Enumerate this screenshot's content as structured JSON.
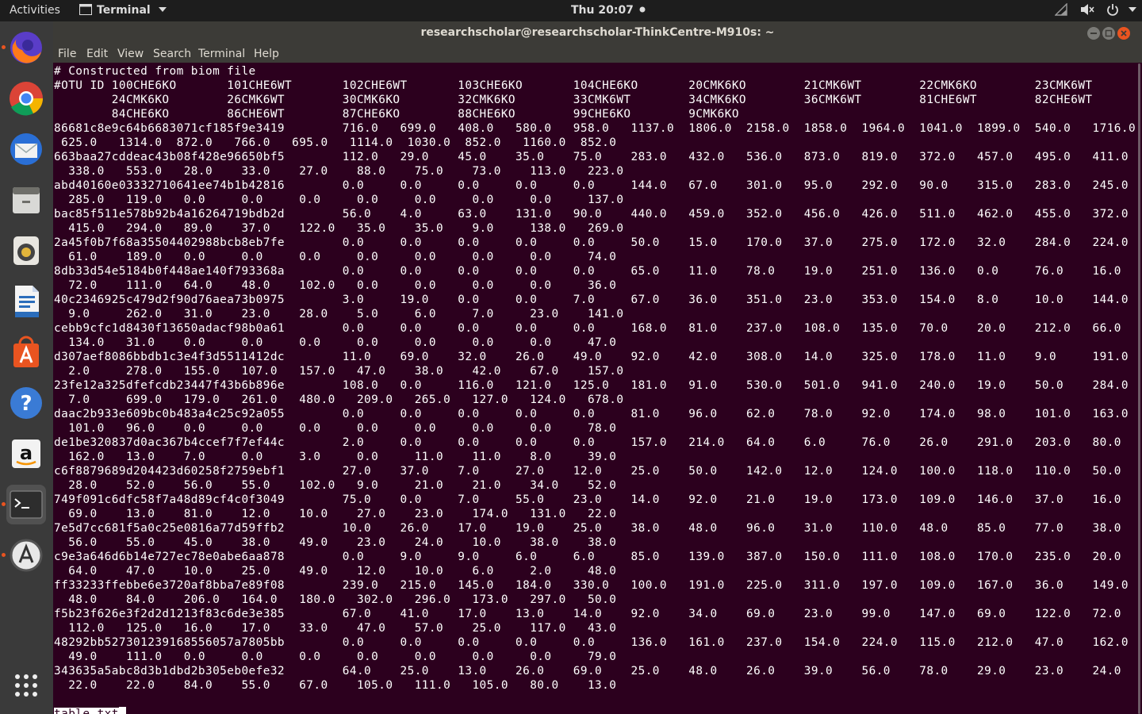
{
  "topbar": {
    "activities": "Activities",
    "app_name": "Terminal",
    "clock": "Thu 20:07"
  },
  "window": {
    "title": "researchscholar@researchscholar-ThinkCentre-M910s: ~"
  },
  "menu": [
    "File",
    "Edit",
    "View",
    "Search",
    "Terminal",
    "Help"
  ],
  "dock": [
    "firefox-icon",
    "chrome-icon",
    "thunderbird-icon",
    "files-icon",
    "rhythmbox-icon",
    "writer-icon",
    "software-center-icon",
    "help-icon",
    "amazon-icon",
    "terminal-icon",
    "software-updater-icon",
    "show-applications-icon"
  ],
  "colors": {
    "terminal_bg": "#2c001e",
    "topbar_bg": "#1d1d1d",
    "window_chrome": "#3c3b37",
    "close_button": "#e95420"
  },
  "terminal": {
    "lines": [
      "# Constructed from biom file",
      "#OTU ID 100CHE6KO       101CHE6WT       102CHE6WT       103CHE6KO       104CHE6KO       20CMK6KO        21CMK6WT        22CMK6KO        23CMK6WT",
      "        24CMK6KO        26CMK6WT        30CMK6KO        32CMK6KO        33CMK6WT        34CMK6KO        36CMK6WT        81CHE6WT        82CHE6WT",
      "        84CHE6KO        86CHE6WT        87CHE6KO        88CHE6KO        99CHE6KO        9CMK6KO",
      "86681c8e9c64b6683071cf185f9e3419        716.0   699.0   408.0   580.0   958.0   1137.0  1806.0  2158.0  1858.0  1964.0  1041.0  1899.0  540.0   1716.0",
      " 625.0   1314.0  872.0   766.0   695.0   1114.0  1030.0  852.0   1160.0  852.0",
      "663baa27cddeac43b08f428e96650bf5        112.0   29.0    45.0    35.0    75.0    283.0   432.0   536.0   873.0   819.0   372.0   457.0   495.0   411.0",
      "  338.0   553.0   28.0    33.0    27.0    88.0    75.0    73.0    113.0   223.0",
      "abd40160e03332710641ee74b1b42816        0.0     0.0     0.0     0.0     0.0     144.0   67.0    301.0   95.0    292.0   90.0    315.0   283.0   245.0",
      "  285.0   119.0   0.0     0.0     0.0     0.0     0.0     0.0     0.0     137.0",
      "bac85f511e578b92b4a16264719bdb2d        56.0    4.0     63.0    131.0   90.0    440.0   459.0   352.0   456.0   426.0   511.0   462.0   455.0   372.0",
      "  415.0   294.0   89.0    37.0    122.0   35.0    35.0    9.0     138.0   269.0",
      "2a45f0b7f68a35504402988bcb8eb7fe        0.0     0.0     0.0     0.0     0.0     50.0    15.0    170.0   37.0    275.0   172.0   32.0    284.0   224.0",
      "  61.0    189.0   0.0     0.0     0.0     0.0     0.0     0.0     0.0     74.0",
      "8db33d54e5184b0f448ae140f793368a        0.0     0.0     0.0     0.0     0.0     65.0    11.0    78.0    19.0    251.0   136.0   0.0     76.0    16.0",
      "  72.0    111.0   64.0    48.0    102.0   0.0     0.0     0.0     0.0     36.0",
      "40c2346925c479d2f90d76aea73b0975        3.0     19.0    0.0     0.0     7.0     67.0    36.0    351.0   23.0    353.0   154.0   8.0     10.0    144.0",
      "  9.0     262.0   31.0    23.0    28.0    5.0     6.0     7.0     23.0    141.0",
      "cebb9cfc1d8430f13650adacf98b0a61        0.0     0.0     0.0     0.0     0.0     168.0   81.0    237.0   108.0   135.0   70.0    20.0    212.0   66.0",
      "  134.0   31.0    0.0     0.0     0.0     0.0     0.0     0.0     0.0     47.0",
      "d307aef8086bbdb1c3e4f3d5511412dc        11.0    69.0    32.0    26.0    49.0    92.0    42.0    308.0   14.0    325.0   178.0   11.0    9.0     191.0",
      "  2.0     278.0   155.0   107.0   157.0   47.0    38.0    42.0    67.0    157.0",
      "23fe12a325dfefcdb23447f43b6b896e        108.0   0.0     116.0   121.0   125.0   181.0   91.0    530.0   501.0   941.0   240.0   19.0    50.0    284.0",
      "  7.0     699.0   179.0   261.0   480.0   209.0   265.0   127.0   124.0   678.0",
      "daac2b933e609bc0b483a4c25c92a055        0.0     0.0     0.0     0.0     0.0     81.0    96.0    62.0    78.0    92.0    174.0   98.0    101.0   163.0",
      "  101.0   96.0    0.0     0.0     0.0     0.0     0.0     0.0     0.0     78.0",
      "de1be320837d0ac367b4ccef7f7ef44c        2.0     0.0     0.0     0.0     0.0     157.0   214.0   64.0    6.0     76.0    26.0    291.0   203.0   80.0",
      "  162.0   13.0    7.0     0.0     3.0     0.0     11.0    11.0    8.0     39.0",
      "c6f8879689d204423d60258f2759ebf1        27.0    37.0    7.0     27.0    12.0    25.0    50.0    142.0   12.0    124.0   100.0   118.0   110.0   50.0",
      "  28.0    52.0    56.0    55.0    102.0   9.0     21.0    21.0    34.0    52.0",
      "749f091c6dfc58f7a48d89cf4c0f3049        75.0    0.0     7.0     55.0    23.0    14.0    92.0    21.0    19.0    173.0   109.0   146.0   37.0    16.0",
      "  69.0    13.0    81.0    12.0    10.0    27.0    23.0    174.0   131.0   22.0",
      "7e5d7cc681f5a0c25e0816a77d59ffb2        10.0    26.0    17.0    19.0    25.0    38.0    48.0    96.0    31.0    110.0   48.0    85.0    77.0    38.0",
      "  56.0    55.0    45.0    38.0    49.0    23.0    24.0    10.0    38.0    38.0",
      "c9e3a646d6b14e727ec78e0abe6aa878        0.0     9.0     9.0     6.0     6.0     85.0    139.0   387.0   150.0   111.0   108.0   170.0   235.0   20.0",
      "  64.0    47.0    10.0    25.0    49.0    12.0    10.0    6.0     2.0     48.0",
      "ff33233ffebbe6e3720af8bba7e89f08        239.0   215.0   145.0   184.0   330.0   100.0   191.0   225.0   311.0   197.0   109.0   167.0   36.0    149.0",
      "  48.0    84.0    206.0   164.0   180.0   302.0   296.0   173.0   297.0   50.0",
      "f5b23f626e3f2d2d1213f83c6de3e385        67.0    41.0    17.0    13.0    14.0    92.0    34.0    69.0    23.0    99.0    147.0   69.0    122.0   72.0",
      "  112.0   125.0   16.0    17.0    33.0    47.0    57.0    25.0    117.0   43.0",
      "48292bb527301239168556057a7805bb        0.0     0.0     0.0     0.0     0.0     136.0   161.0   237.0   154.0   224.0   115.0   212.0   47.0    162.0",
      "  49.0    111.0   0.0     0.0     0.0     0.0     0.0     0.0     0.0     79.0",
      "343635a5abc8d3b1dbd2b305eb0efe32        64.0    25.0    13.0    26.0    69.0    25.0    48.0    26.0    39.0    56.0    78.0    29.0    23.0    24.0",
      "  22.0    22.0    84.0    55.0    67.0    105.0   111.0   105.0   80.0    13.0"
    ],
    "prompt_text": "table.txt"
  }
}
